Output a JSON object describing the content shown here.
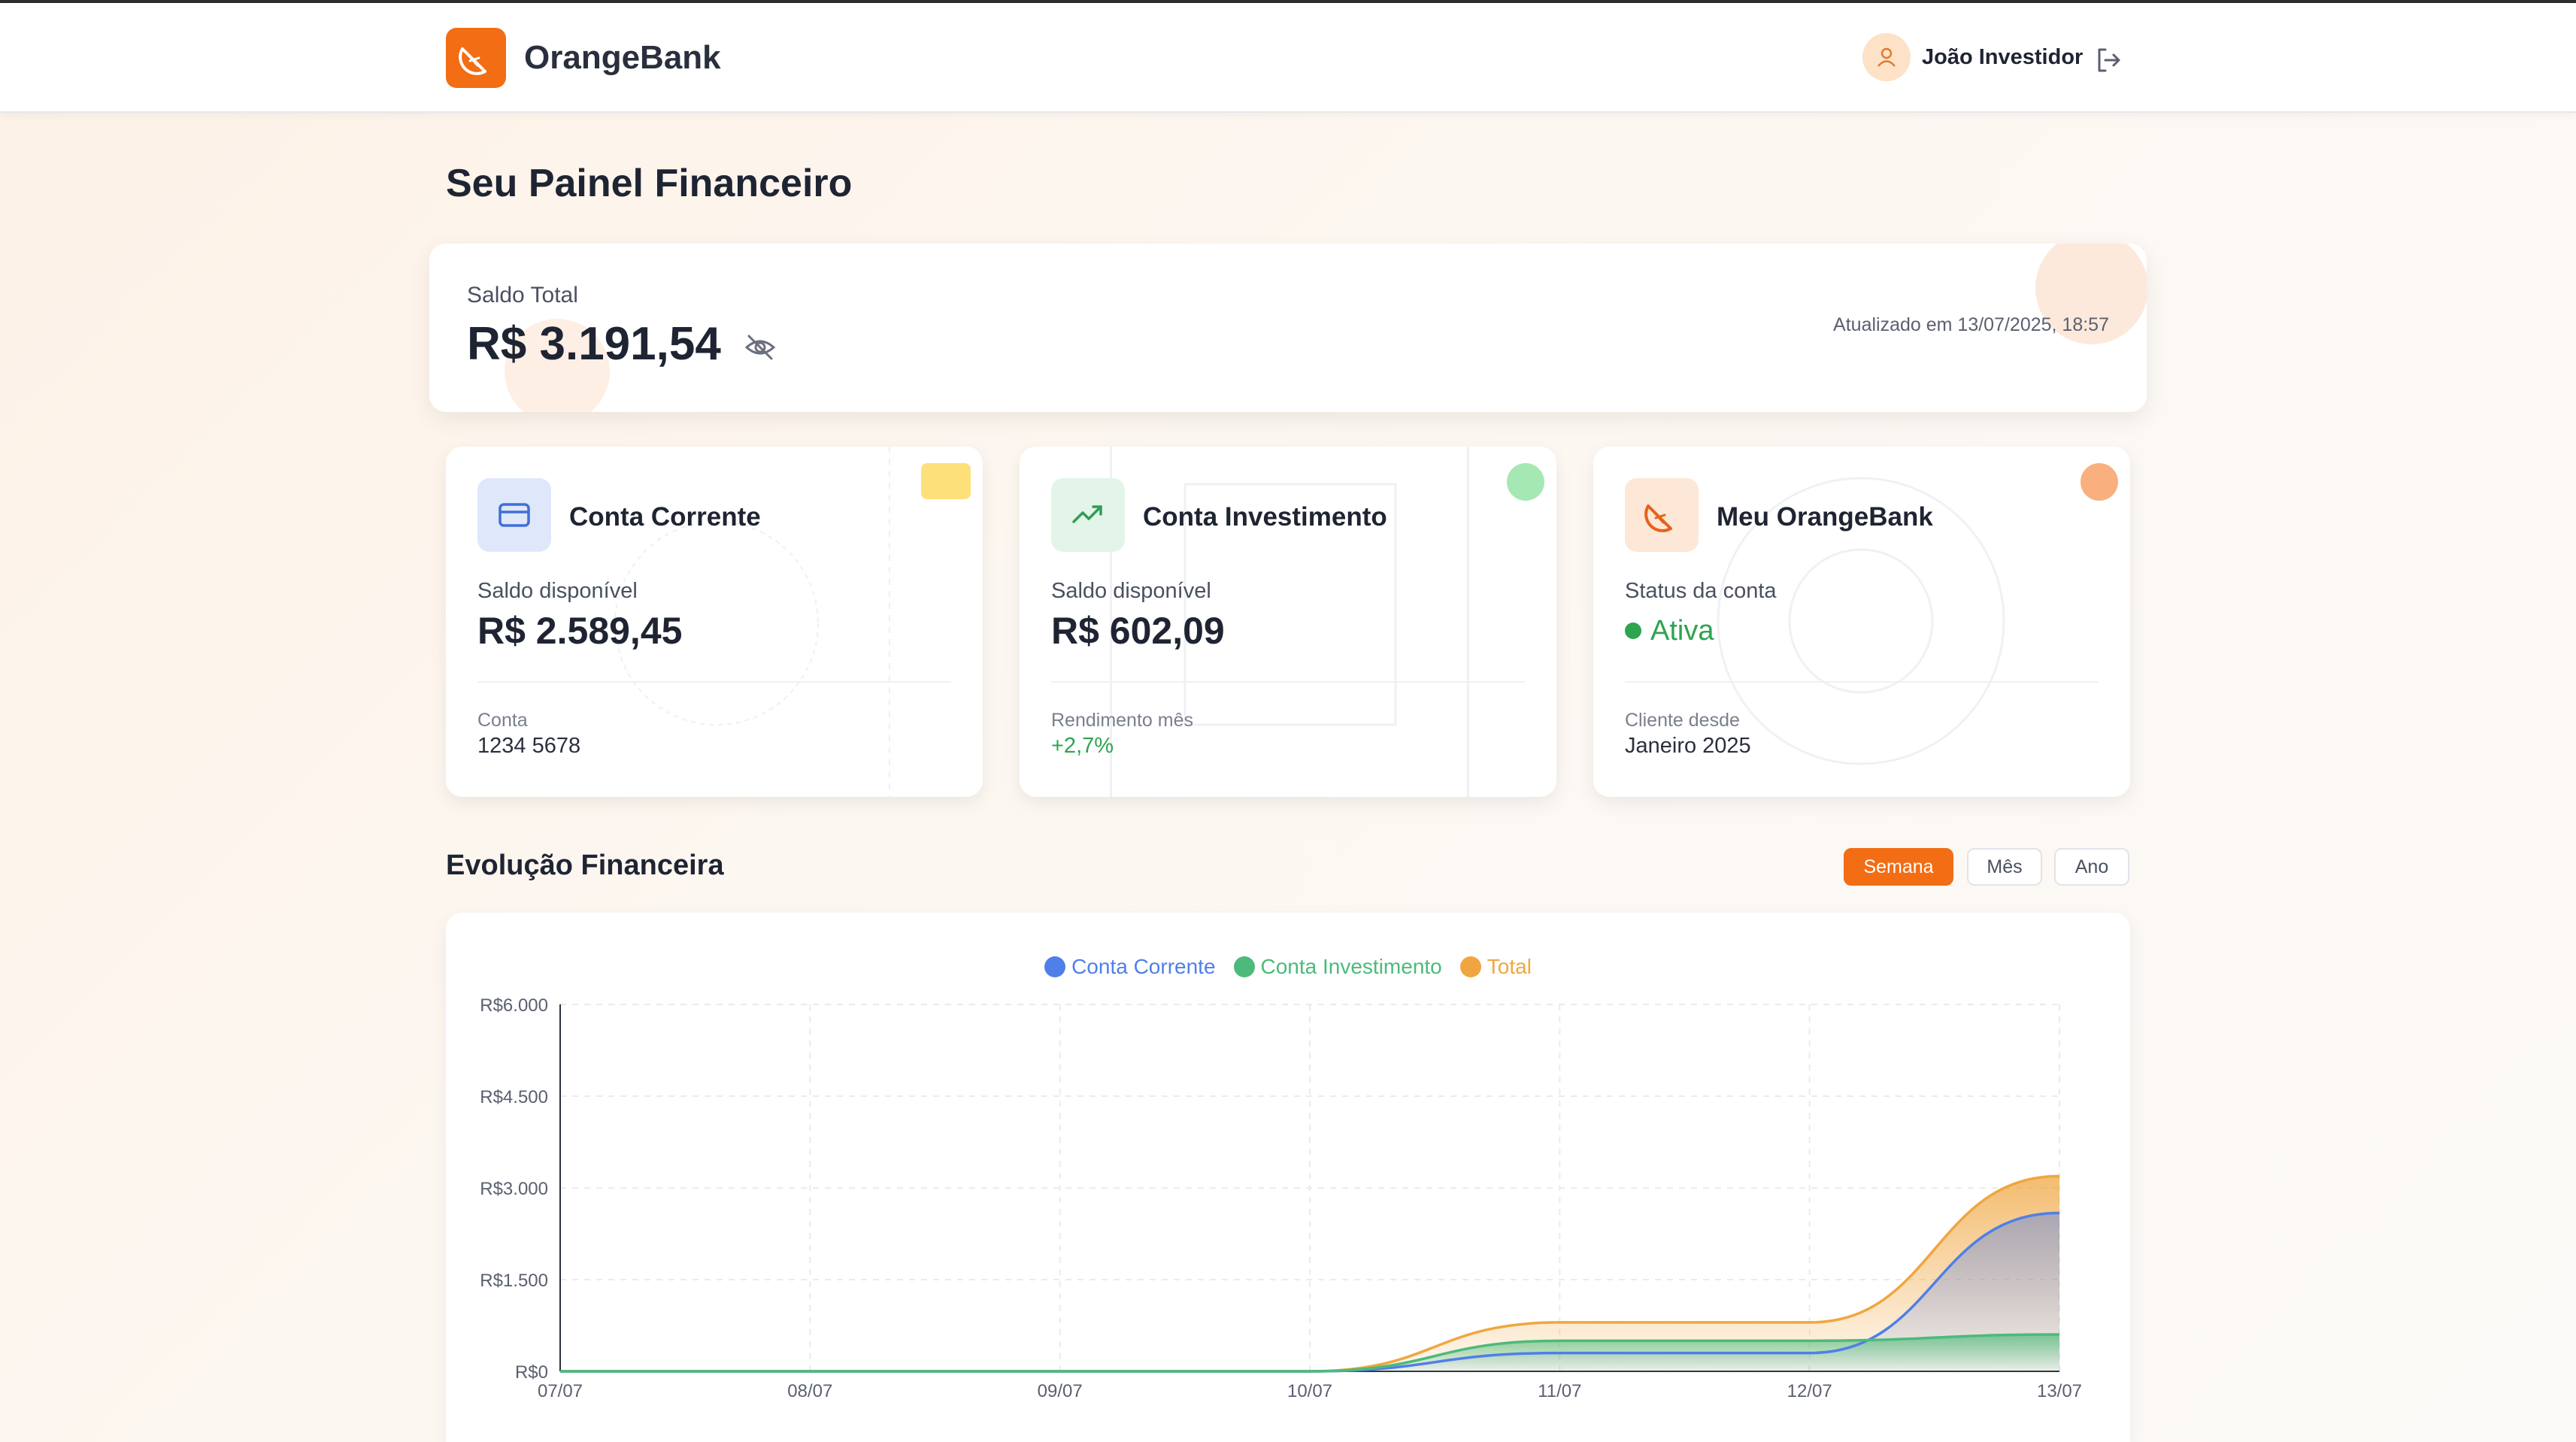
{
  "header": {
    "brand": "OrangeBank",
    "user_name": "João Investidor",
    "logo_icon": "orange-slice-icon",
    "avatar_icon": "user-icon",
    "logout_icon": "logout-icon"
  },
  "page": {
    "title": "Seu Painel Financeiro"
  },
  "balance": {
    "label": "Saldo Total",
    "value": "R$ 3.191,54",
    "updated": "Atualizado em 13/07/2025, 18:57",
    "visibility_icon": "eye-off-icon"
  },
  "accounts": [
    {
      "title": "Conta Corrente",
      "sub_label": "Saldo disponível",
      "value": "R$ 2.589,45",
      "foot_label": "Conta",
      "foot_value": "1234 5678",
      "icon": "credit-card-icon"
    },
    {
      "title": "Conta Investimento",
      "sub_label": "Saldo disponível",
      "value": "R$ 602,09",
      "foot_label": "Rendimento mês",
      "foot_value": "+2,7%",
      "icon": "trending-up-icon"
    },
    {
      "title": "Meu OrangeBank",
      "sub_label": "Status da conta",
      "value": "Ativa",
      "foot_label": "Cliente desde",
      "foot_value": "Janeiro 2025",
      "icon": "orange-slice-icon"
    }
  ],
  "evolution": {
    "title": "Evolução Financeira",
    "periods": [
      "Semana",
      "Mês",
      "Ano"
    ],
    "active_period": "Semana"
  },
  "colors": {
    "accent": "#f26d13",
    "conta_corrente": "#4f7fe8",
    "conta_investimento": "#4cba7a",
    "total": "#f0a640",
    "positive": "#2ea44f"
  },
  "chart_data": {
    "type": "area",
    "x": [
      "07/07",
      "08/07",
      "09/07",
      "10/07",
      "11/07",
      "12/07",
      "13/07"
    ],
    "series": [
      {
        "name": "Conta Corrente",
        "values": [
          0,
          0,
          0,
          0,
          300,
          300,
          2589.45
        ]
      },
      {
        "name": "Conta Investimento",
        "values": [
          0,
          0,
          0,
          0,
          500,
          500,
          602.09
        ]
      },
      {
        "name": "Total",
        "values": [
          0,
          0,
          0,
          0,
          800,
          800,
          3191.54
        ]
      }
    ],
    "y_ticks": [
      "R$0",
      "R$1.500",
      "R$3.000",
      "R$4.500",
      "R$6.000"
    ],
    "ylim": [
      0,
      6000
    ],
    "grid": true,
    "legend_position": "top-center"
  }
}
